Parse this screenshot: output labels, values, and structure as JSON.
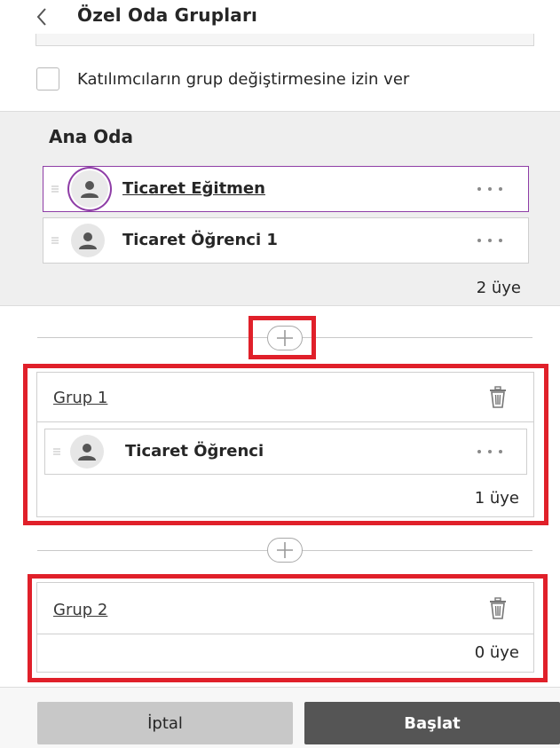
{
  "header": {
    "title": "Özel Oda Grupları"
  },
  "settings": {
    "allow_switch_label": "Katılımcıların grup değiştirmesine izin ver",
    "allow_switch_checked": false
  },
  "main_room": {
    "title": "Ana Oda",
    "members": [
      {
        "name": "Ticaret Eğitmen",
        "role": "instructor"
      },
      {
        "name": "Ticaret Öğrenci 1",
        "role": "student"
      }
    ],
    "count": "2 üye"
  },
  "groups": [
    {
      "name": "Grup 1",
      "members": [
        {
          "name": "Ticaret Öğrenci"
        }
      ],
      "count": "1 üye"
    },
    {
      "name": "Grup 2",
      "members": [],
      "count": "0 üye"
    }
  ],
  "footer": {
    "cancel_label": "İptal",
    "start_label": "Başlat"
  },
  "colors": {
    "instructor_ring": "#8e3da6",
    "highlight": "#e0202a",
    "start_button": "#555555",
    "cancel_button": "#c8c8c8"
  },
  "icons": {
    "back": "chevron-left-icon",
    "avatar": "person-icon",
    "menu": "more-horizontal-icon",
    "add": "plus-circle-icon",
    "delete": "trash-icon",
    "drag": "drag-handle-icon"
  }
}
